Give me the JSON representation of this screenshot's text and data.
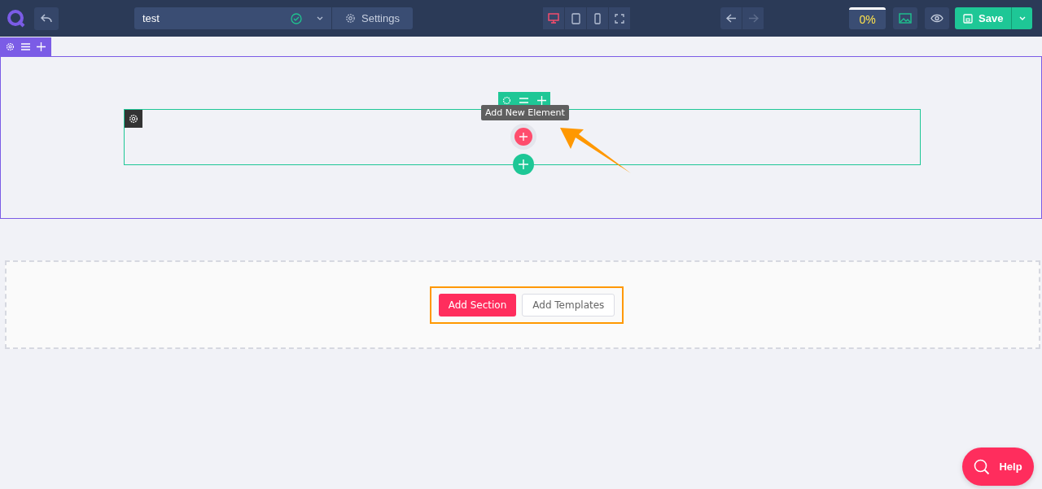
{
  "topbar": {
    "page_name": "test",
    "settings_label": "Settings",
    "devices": [
      {
        "kind": "desktop",
        "selected": true
      },
      {
        "kind": "tablet",
        "selected": false
      },
      {
        "kind": "mobile",
        "selected": false
      },
      {
        "kind": "fullscreen",
        "selected": false
      }
    ],
    "history": [
      {
        "kind": "undo",
        "disabled": false
      },
      {
        "kind": "redo",
        "disabled": true
      }
    ],
    "progress": "0%",
    "save_label": "Save"
  },
  "canvas": {
    "tooltip": "Add New Element"
  },
  "empty_section": {
    "buttons": [
      {
        "kind": "primary",
        "label": "Add Section"
      },
      {
        "kind": "secondary",
        "label": "Add Templates"
      }
    ]
  },
  "help_label": "Help"
}
